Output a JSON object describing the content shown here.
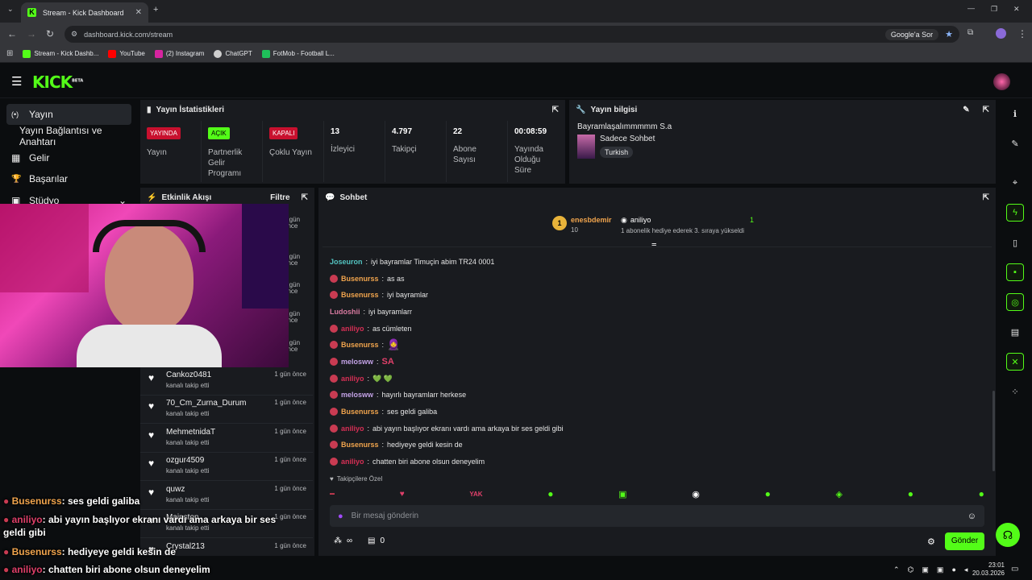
{
  "browser": {
    "tab_title": "Stream - Kick Dashboard",
    "url": "dashboard.kick.com/stream",
    "google_button": "Google'a Sor",
    "bookmarks": [
      {
        "label": "Stream - Kick Dashb...",
        "color": "#53fc18"
      },
      {
        "label": "YouTube",
        "color": "#ff0000"
      },
      {
        "label": "(2) Instagram",
        "color": "#d6249f"
      },
      {
        "label": "ChatGPT",
        "color": "#cfcfcf"
      },
      {
        "label": "FotMob - Football L...",
        "color": "#1fbf5a"
      }
    ]
  },
  "app": {
    "logo": "KICK",
    "logo_tag": "BETA"
  },
  "sidebar": {
    "items": [
      {
        "label": "Yayın",
        "icon": "(•)"
      },
      {
        "label": "Yayın Bağlantısı ve Anahtarı",
        "icon": ""
      },
      {
        "label": "Gelir",
        "icon": "▦"
      },
      {
        "label": "Başarılar",
        "icon": "🏆"
      },
      {
        "label": "Stüdyo",
        "icon": "▣"
      }
    ]
  },
  "stats_panel": {
    "title": "Yayın İstatistikleri",
    "items": [
      {
        "chip": "YAYINDA",
        "chip_color": "#c8102e",
        "label": "Yayın"
      },
      {
        "chip": "AÇIK",
        "chip_color": "#53fc18",
        "label": "Partnerlik Gelir Programı"
      },
      {
        "chip": "KAPALI",
        "chip_color": "#c8102e",
        "label": "Çoklu Yayın"
      },
      {
        "value": "13",
        "label": "İzleyici"
      },
      {
        "value": "4.797",
        "label": "Takipçi"
      },
      {
        "value": "22",
        "label": "Abone Sayısı"
      },
      {
        "value": "00:08:59",
        "label": "Yayında Olduğu Süre"
      }
    ]
  },
  "info_panel": {
    "title": "Yayın bilgisi",
    "stream_title": "Bayramlaşalımmmmm S.a",
    "category": "Sadece Sohbet",
    "language": "Turkish"
  },
  "activity_panel": {
    "title": "Etkinlik Akışı",
    "filter": "Filtre",
    "hidden_times": [
      "1 gün önce",
      "1 gün önce",
      "1 gün önce",
      "1 gün önce",
      "1 gün önce",
      "1 gün önce"
    ],
    "events": [
      {
        "name": "Cankoz0481",
        "action": "kanalı takip etti",
        "time": "1 gün önce"
      },
      {
        "name": "70_Cm_Zurna_Durum",
        "action": "kanalı takip etti",
        "time": "1 gün önce"
      },
      {
        "name": "MehmetnidaT",
        "action": "kanalı takip etti",
        "time": "1 gün önce"
      },
      {
        "name": "ozgur4509",
        "action": "kanalı takip etti",
        "time": "1 gün önce"
      },
      {
        "name": "quwz",
        "action": "kanalı takip etti",
        "time": "1 gün önce"
      },
      {
        "name": "Mainston",
        "action": "kanalı takip etti",
        "time": "1 gün önce"
      },
      {
        "name": "Crystal213",
        "action": "",
        "time": "1 gün önce"
      }
    ]
  },
  "chat_panel": {
    "title": "Sohbet",
    "pinned": {
      "rank": "1",
      "user": "enesbdemir",
      "user_sub": "10",
      "gifter": "aniliyo",
      "gift_count": "1",
      "text": "1 abonelik hediye ederek 3. sıraya yükseldi"
    },
    "messages": [
      {
        "user": "Joseuron",
        "cls": "u4",
        "badge": false,
        "text": "iyi bayramlar Timuçin abim TR24 0001"
      },
      {
        "user": "Busenurss",
        "cls": "u1",
        "badge": true,
        "text": "as as"
      },
      {
        "user": "Busenurss",
        "cls": "u1",
        "badge": true,
        "text": "iyi bayramlar"
      },
      {
        "user": "Ludoshii",
        "cls": "u3",
        "badge": false,
        "text": "iyi bayramlarr"
      },
      {
        "user": "aniliyo",
        "cls": "u2",
        "badge": true,
        "text": "as cümleten"
      },
      {
        "user": "Busenurss",
        "cls": "u1",
        "badge": true,
        "text": "🧕"
      },
      {
        "user": "melosww",
        "cls": "u5",
        "badge": true,
        "text": "SA"
      },
      {
        "user": "aniliyo",
        "cls": "u2",
        "badge": true,
        "text": "💚 💚"
      },
      {
        "user": "melosww",
        "cls": "u5",
        "badge": true,
        "text": "hayırlı bayramlarr herkese"
      },
      {
        "user": "Busenurss",
        "cls": "u1",
        "badge": true,
        "text": "ses geldi galiba"
      },
      {
        "user": "aniliyo",
        "cls": "u2",
        "badge": true,
        "text": "abi yayın başlıyor ekranı vardı ama arkaya bir ses geldi gibi"
      },
      {
        "user": "Busenurss",
        "cls": "u1",
        "badge": true,
        "text": "hediyeye geldi kesin de"
      },
      {
        "user": "aniliyo",
        "cls": "u2",
        "badge": true,
        "text": "chatten biri abone olsun deneyelim"
      }
    ],
    "followers_only": "Takipçilere Özel",
    "emote_labels": [
      "YAK"
    ],
    "input_placeholder": "Bir mesaj gönderin",
    "points": "∞",
    "gift_count": "0",
    "send": "Gönder"
  },
  "overlay_chat": [
    {
      "user": "Busenurss",
      "text": "ses geldi galiba",
      "color": "#f0a44d"
    },
    {
      "user": "aniliyo",
      "text": "abi yayın başlıyor ekranı vardı ama arkaya bir ses geldi gibi",
      "color": "#e0406a"
    },
    {
      "user": "Busenurss",
      "text": "hediyeye geldi kesin de",
      "color": "#f0a44d"
    },
    {
      "user": "aniliyo",
      "text": "chatten biri abone olsun deneyelim",
      "color": "#e0406a"
    }
  ],
  "taskbar": {
    "time": "23:01",
    "date": "20.03.2026"
  }
}
